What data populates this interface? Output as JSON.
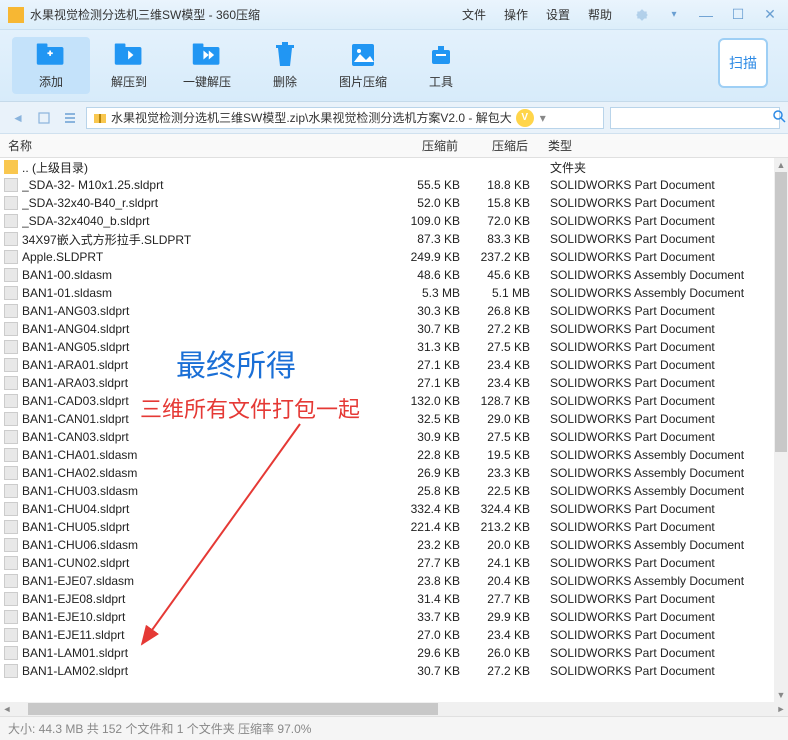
{
  "titlebar": {
    "title": "水果视觉检测分选机三维SW模型 - 360压缩"
  },
  "menu": {
    "file": "文件",
    "operate": "操作",
    "settings": "设置",
    "help": "帮助"
  },
  "toolbar": {
    "add": "添加",
    "extract_to": "解压到",
    "one_click": "一键解压",
    "delete": "删除",
    "image_compress": "图片压缩",
    "tools": "工具",
    "scan": "扫描"
  },
  "pathbar": {
    "path": "水果视觉检测分选机三维SW模型.zip\\水果视觉检测分选机方案V2.0 - 解包大",
    "vip": "V"
  },
  "columns": {
    "name": "名称",
    "before": "压缩前",
    "after": "压缩后",
    "type": "类型"
  },
  "parent_dir": ".. (上级目录)",
  "folder_type": "文件夹",
  "files": [
    {
      "name": "_SDA-32- M10x1.25.sldprt",
      "before": "55.5 KB",
      "after": "18.8 KB",
      "type": "SOLIDWORKS Part Document"
    },
    {
      "name": "_SDA-32x40-B40_r.sldprt",
      "before": "52.0 KB",
      "after": "15.8 KB",
      "type": "SOLIDWORKS Part Document"
    },
    {
      "name": "_SDA-32x4040_b.sldprt",
      "before": "109.0 KB",
      "after": "72.0 KB",
      "type": "SOLIDWORKS Part Document"
    },
    {
      "name": "34X97嵌入式方形拉手.SLDPRT",
      "before": "87.3 KB",
      "after": "83.3 KB",
      "type": "SOLIDWORKS Part Document"
    },
    {
      "name": "Apple.SLDPRT",
      "before": "249.9 KB",
      "after": "237.2 KB",
      "type": "SOLIDWORKS Part Document"
    },
    {
      "name": "BAN1-00.sldasm",
      "before": "48.6 KB",
      "after": "45.6 KB",
      "type": "SOLIDWORKS Assembly Document"
    },
    {
      "name": "BAN1-01.sldasm",
      "before": "5.3 MB",
      "after": "5.1 MB",
      "type": "SOLIDWORKS Assembly Document"
    },
    {
      "name": "BAN1-ANG03.sldprt",
      "before": "30.3 KB",
      "after": "26.8 KB",
      "type": "SOLIDWORKS Part Document"
    },
    {
      "name": "BAN1-ANG04.sldprt",
      "before": "30.7 KB",
      "after": "27.2 KB",
      "type": "SOLIDWORKS Part Document"
    },
    {
      "name": "BAN1-ANG05.sldprt",
      "before": "31.3 KB",
      "after": "27.5 KB",
      "type": "SOLIDWORKS Part Document"
    },
    {
      "name": "BAN1-ARA01.sldprt",
      "before": "27.1 KB",
      "after": "23.4 KB",
      "type": "SOLIDWORKS Part Document"
    },
    {
      "name": "BAN1-ARA03.sldprt",
      "before": "27.1 KB",
      "after": "23.4 KB",
      "type": "SOLIDWORKS Part Document"
    },
    {
      "name": "BAN1-CAD03.sldprt",
      "before": "132.0 KB",
      "after": "128.7 KB",
      "type": "SOLIDWORKS Part Document"
    },
    {
      "name": "BAN1-CAN01.sldprt",
      "before": "32.5 KB",
      "after": "29.0 KB",
      "type": "SOLIDWORKS Part Document"
    },
    {
      "name": "BAN1-CAN03.sldprt",
      "before": "30.9 KB",
      "after": "27.5 KB",
      "type": "SOLIDWORKS Part Document"
    },
    {
      "name": "BAN1-CHA01.sldasm",
      "before": "22.8 KB",
      "after": "19.5 KB",
      "type": "SOLIDWORKS Assembly Document"
    },
    {
      "name": "BAN1-CHA02.sldasm",
      "before": "26.9 KB",
      "after": "23.3 KB",
      "type": "SOLIDWORKS Assembly Document"
    },
    {
      "name": "BAN1-CHU03.sldasm",
      "before": "25.8 KB",
      "after": "22.5 KB",
      "type": "SOLIDWORKS Assembly Document"
    },
    {
      "name": "BAN1-CHU04.sldprt",
      "before": "332.4 KB",
      "after": "324.4 KB",
      "type": "SOLIDWORKS Part Document"
    },
    {
      "name": "BAN1-CHU05.sldprt",
      "before": "221.4 KB",
      "after": "213.2 KB",
      "type": "SOLIDWORKS Part Document"
    },
    {
      "name": "BAN1-CHU06.sldasm",
      "before": "23.2 KB",
      "after": "20.0 KB",
      "type": "SOLIDWORKS Assembly Document"
    },
    {
      "name": "BAN1-CUN02.sldprt",
      "before": "27.7 KB",
      "after": "24.1 KB",
      "type": "SOLIDWORKS Part Document"
    },
    {
      "name": "BAN1-EJE07.sldasm",
      "before": "23.8 KB",
      "after": "20.4 KB",
      "type": "SOLIDWORKS Assembly Document"
    },
    {
      "name": "BAN1-EJE08.sldprt",
      "before": "31.4 KB",
      "after": "27.7 KB",
      "type": "SOLIDWORKS Part Document"
    },
    {
      "name": "BAN1-EJE10.sldprt",
      "before": "33.7 KB",
      "after": "29.9 KB",
      "type": "SOLIDWORKS Part Document"
    },
    {
      "name": "BAN1-EJE11.sldprt",
      "before": "27.0 KB",
      "after": "23.4 KB",
      "type": "SOLIDWORKS Part Document"
    },
    {
      "name": "BAN1-LAM01.sldprt",
      "before": "29.6 KB",
      "after": "26.0 KB",
      "type": "SOLIDWORKS Part Document"
    },
    {
      "name": "BAN1-LAM02.sldprt",
      "before": "30.7 KB",
      "after": "27.2 KB",
      "type": "SOLIDWORKS Part Document"
    }
  ],
  "annotation": {
    "title": "最终所得",
    "subtitle": "三维所有文件打包一起"
  },
  "statusbar": {
    "text": "大小: 44.3 MB 共 152 个文件和 1 个文件夹 压缩率 97.0%"
  }
}
